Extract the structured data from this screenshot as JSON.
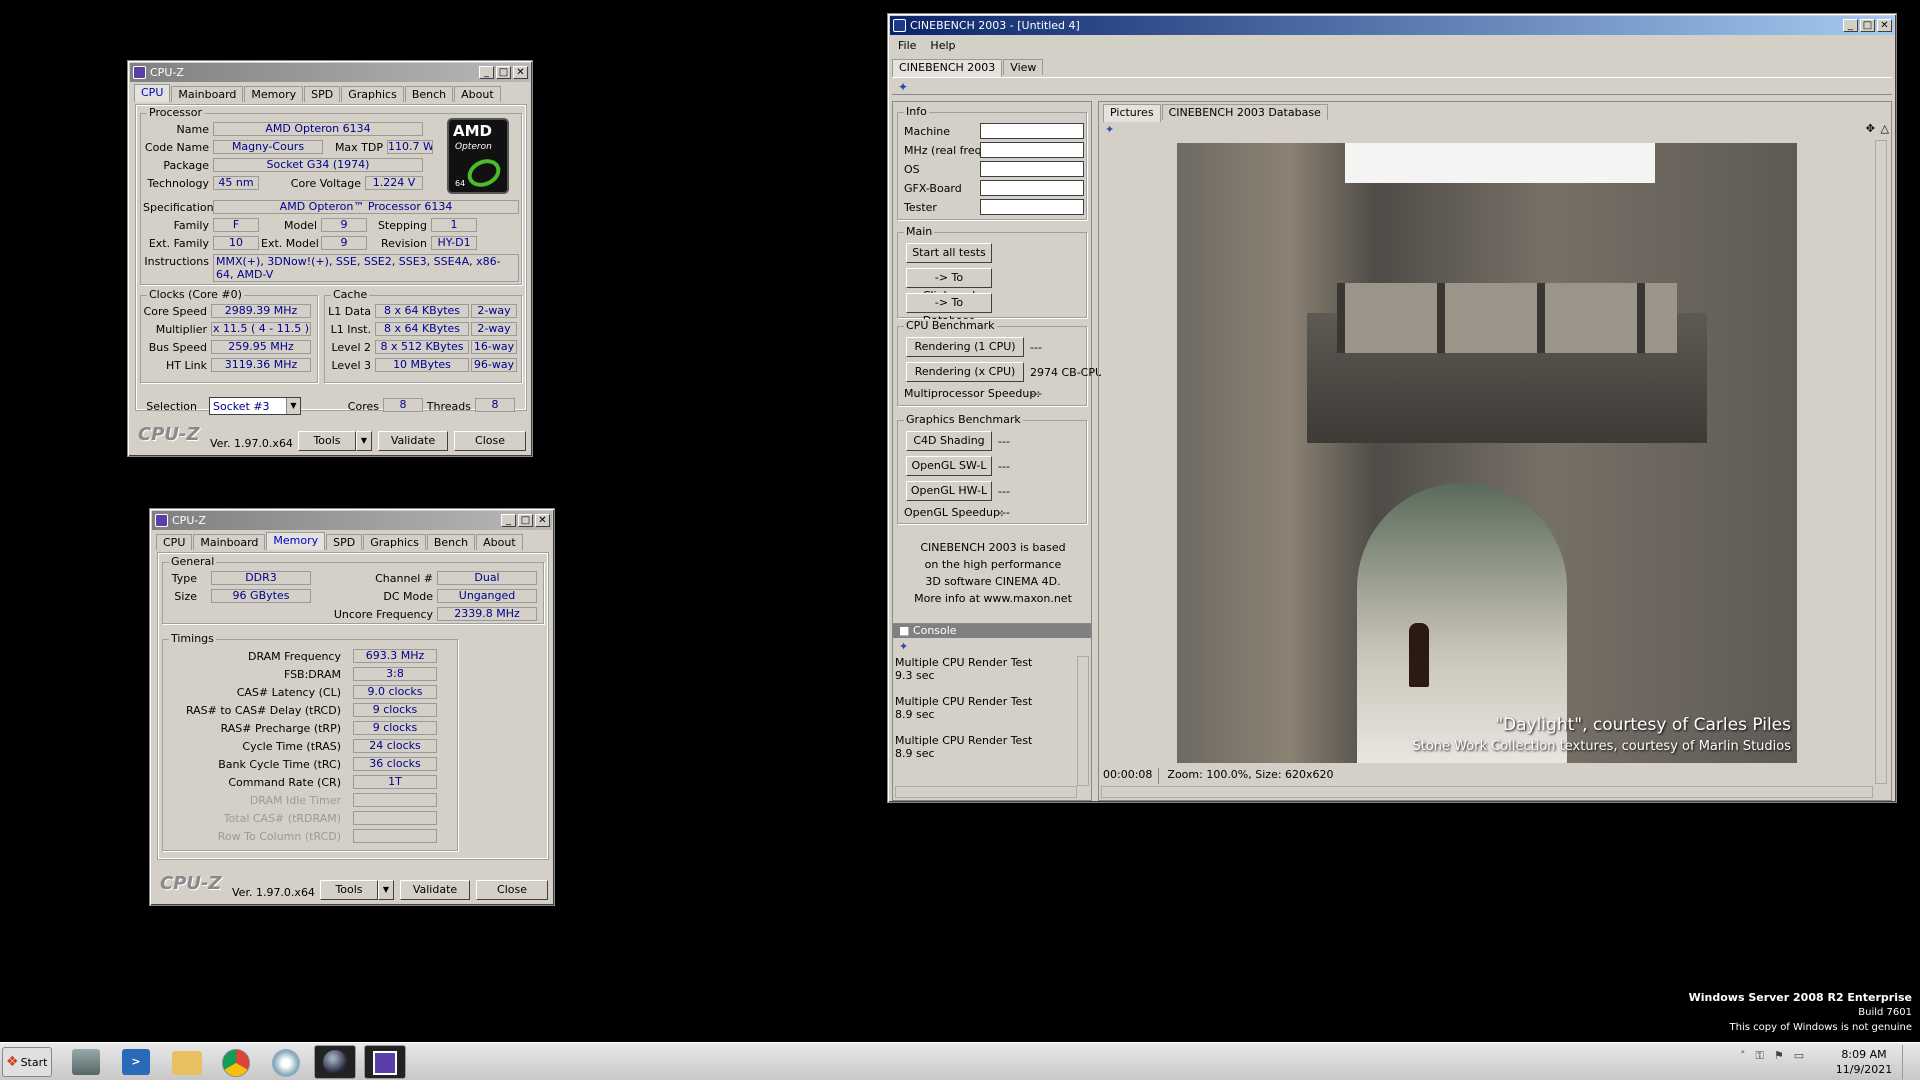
{
  "cpuz1": {
    "title": "CPU-Z",
    "tabs": [
      "CPU",
      "Mainboard",
      "Memory",
      "SPD",
      "Graphics",
      "Bench",
      "About"
    ],
    "processor_label": "Processor",
    "name_label": "Name",
    "name": "AMD Opteron 6134",
    "codename_label": "Code Name",
    "codename": "Magny-Cours",
    "maxtdp_label": "Max TDP",
    "maxtdp": "110.7 W",
    "package_label": "Package",
    "package": "Socket G34 (1974)",
    "tech_label": "Technology",
    "tech": "45 nm",
    "cv_label": "Core Voltage",
    "cv": "1.224 V",
    "spec_label": "Specification",
    "spec": "AMD Opteron™ Processor 6134",
    "family_label": "Family",
    "family": "F",
    "model_label": "Model",
    "model": "9",
    "stepping_label": "Stepping",
    "stepping": "1",
    "extfam_label": "Ext. Family",
    "extfam": "10",
    "extmodel_label": "Ext. Model",
    "extmodel": "9",
    "revision_label": "Revision",
    "revision": "HY-D1",
    "instr_label": "Instructions",
    "instr": "MMX(+), 3DNow!(+), SSE, SSE2, SSE3, SSE4A, x86-64, AMD-V",
    "clocks_label": "Clocks (Core #0)",
    "cs_label": "Core Speed",
    "cs": "2989.39 MHz",
    "mult_label": "Multiplier",
    "mult": "x 11.5 ( 4 - 11.5 )",
    "bus_label": "Bus Speed",
    "bus": "259.95 MHz",
    "ht_label": "HT Link",
    "ht": "3119.36 MHz",
    "cache_label": "Cache",
    "l1d_label": "L1 Data",
    "l1d": "8 x 64 KBytes",
    "l1d_w": "2-way",
    "l1i_label": "L1 Inst.",
    "l1i": "8 x 64 KBytes",
    "l1i_w": "2-way",
    "l2_label": "Level 2",
    "l2": "8 x 512 KBytes",
    "l2_w": "16-way",
    "l3_label": "Level 3",
    "l3": "10 MBytes",
    "l3_w": "96-way",
    "sel_label": "Selection",
    "sel": "Socket #3",
    "cores_label": "Cores",
    "cores": "8",
    "threads_label": "Threads",
    "threads": "8",
    "logo": "CPU-Z",
    "ver": "Ver. 1.97.0.x64",
    "tools": "Tools",
    "validate": "Validate",
    "close": "Close",
    "amd_brand": "AMD",
    "amd_sub": "Opteron",
    "amd_64": "64"
  },
  "cpuz2": {
    "title": "CPU-Z",
    "general_label": "General",
    "type_label": "Type",
    "type": "DDR3",
    "size_label": "Size",
    "size": "96 GBytes",
    "chan_label": "Channel #",
    "chan": "Dual",
    "dc_label": "DC Mode",
    "dc": "Unganged",
    "uf_label": "Uncore Frequency",
    "uf": "2339.8 MHz",
    "timings_label": "Timings",
    "timings": [
      {
        "l": "DRAM Frequency",
        "v": "693.3 MHz",
        "d": false
      },
      {
        "l": "FSB:DRAM",
        "v": "3:8",
        "d": false
      },
      {
        "l": "CAS# Latency (CL)",
        "v": "9.0 clocks",
        "d": false
      },
      {
        "l": "RAS# to CAS# Delay (tRCD)",
        "v": "9 clocks",
        "d": false
      },
      {
        "l": "RAS# Precharge (tRP)",
        "v": "9 clocks",
        "d": false
      },
      {
        "l": "Cycle Time (tRAS)",
        "v": "24 clocks",
        "d": false
      },
      {
        "l": "Bank Cycle Time (tRC)",
        "v": "36 clocks",
        "d": false
      },
      {
        "l": "Command Rate (CR)",
        "v": "1T",
        "d": false
      },
      {
        "l": "DRAM Idle Timer",
        "v": "",
        "d": true
      },
      {
        "l": "Total CAS# (tRDRAM)",
        "v": "",
        "d": true
      },
      {
        "l": "Row To Column (tRCD)",
        "v": "",
        "d": true
      }
    ],
    "logo": "CPU-Z",
    "ver": "Ver. 1.97.0.x64",
    "tools": "Tools",
    "validate": "Validate",
    "close": "Close"
  },
  "cb": {
    "title": "CINEBENCH 2003 - [Untitled 4]",
    "menu_file": "File",
    "menu_help": "Help",
    "tab_cb": "CINEBENCH 2003",
    "tab_view": "View",
    "info_label": "Info",
    "machine": "Machine",
    "mhz": "MHz (real freq.)",
    "os": "OS",
    "gfx": "GFX-Board",
    "tester": "Tester",
    "main_label": "Main",
    "start_all": "Start all tests",
    "to_clip": "-> To Clipboard",
    "to_db": "-> To Database",
    "cpu_label": "CPU Benchmark",
    "r1": "Rendering (1 CPU)",
    "r1v": "---",
    "rx": "Rendering (x CPU)",
    "rxv": "2974 CB-CPU",
    "mps": "Multiprocessor Speedup:",
    "mpsv": "---",
    "gfx_label": "Graphics Benchmark",
    "c4d": "C4D Shading",
    "c4dv": "---",
    "swl": "OpenGL SW-L",
    "swlv": "---",
    "hwl": "OpenGL HW-L",
    "hwlv": "---",
    "ogs": "OpenGL Speedup:",
    "ogsv": "---",
    "about1": "CINEBENCH 2003 is based",
    "about2": "on the high performance",
    "about3": "3D software CINEMA 4D.",
    "about4": "More info at www.maxon.net",
    "console": "Console",
    "console_lines": [
      "Multiple CPU Render Test",
      "9.3 sec",
      "",
      "Multiple CPU Render Test",
      "8.9 sec",
      "",
      "Multiple CPU Render Test",
      "8.9 sec"
    ],
    "tab_pictures": "Pictures",
    "tab_db": "CINEBENCH 2003 Database",
    "credit1": "\"Daylight\", courtesy of Carles Piles",
    "credit2": "Stone Work Collection textures, courtesy of Marlin Studios",
    "status": "00:00:08",
    "status2": "Zoom: 100.0%, Size: 620x620"
  },
  "desktop": {
    "os": "Windows Server 2008 R2 Enterprise",
    "build": "Build 7601",
    "genuine": "This copy of Windows is not genuine"
  },
  "taskbar": {
    "start": "Start",
    "time": "8:09 AM",
    "date": "11/9/2021"
  }
}
